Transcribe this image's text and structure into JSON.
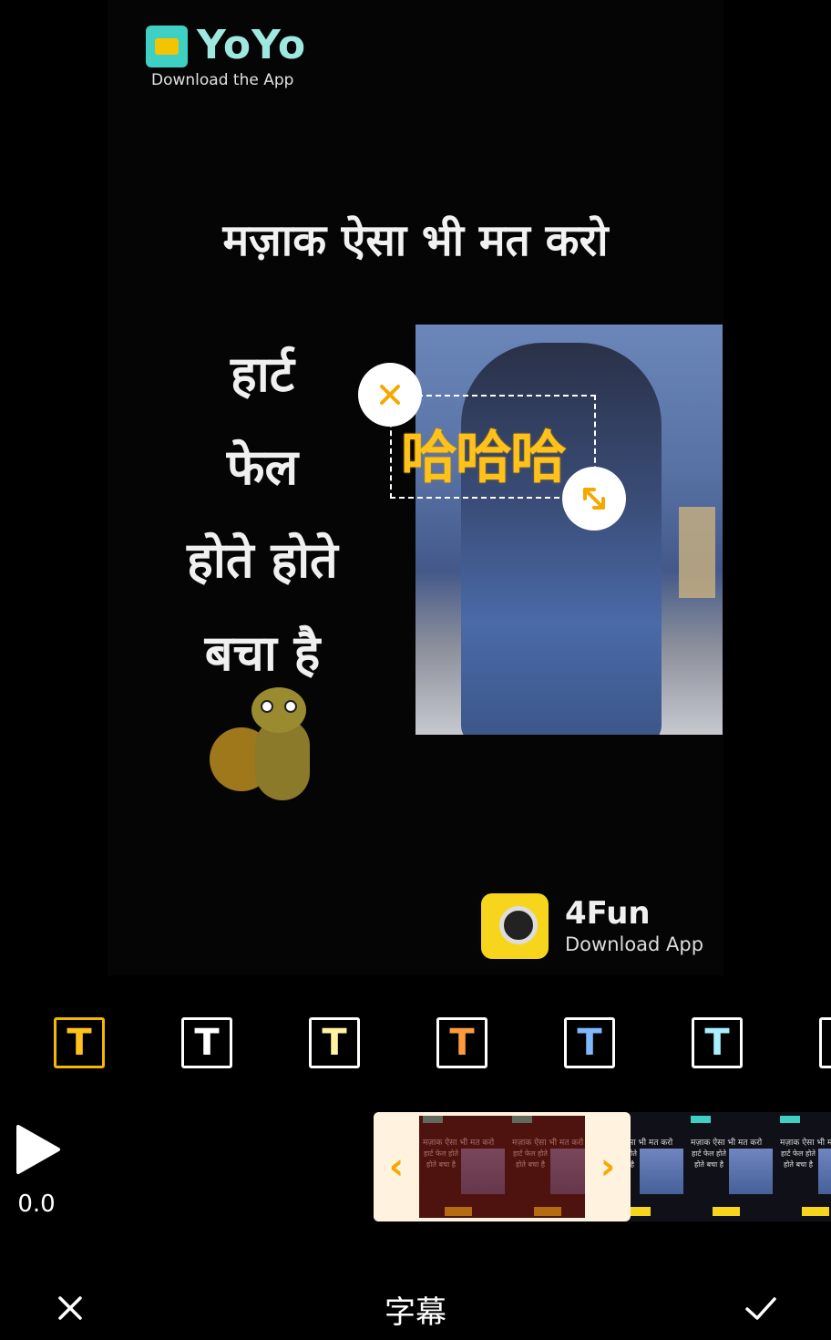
{
  "preview": {
    "watermark_top": {
      "name": "YoYo",
      "subtitle": "Download the App"
    },
    "title": "मज़ाक ऐसा भी मत करो",
    "lines": [
      "हार्ट",
      "फेल",
      "होते होते",
      "बचा है"
    ],
    "watermark_bottom": {
      "name": "4Fun",
      "subtitle": "Download App"
    }
  },
  "overlay": {
    "text": "哈哈哈",
    "text_color": "#ffc21a",
    "close_icon": "close-icon",
    "resize_icon": "resize-arrows-icon"
  },
  "styles": {
    "glyph": "T",
    "items": [
      {
        "fill": "#ffc21a",
        "active": true
      },
      {
        "fill": "#ffffff",
        "active": false
      },
      {
        "fill": "#fff3a0",
        "active": false
      },
      {
        "fill": "#ff9a3c",
        "active": false
      },
      {
        "fill": "#7fb8ff",
        "active": false
      },
      {
        "fill": "#a8f0ff",
        "active": false
      }
    ]
  },
  "timeline": {
    "time": "0.0",
    "play_icon": "play-icon",
    "left_handle": "‹",
    "right_handle": "›",
    "frame_title": "मज़ाक ऐसा भी मत करो",
    "frame_lines": "हार्ट फेल होते होते बचा है",
    "selection_color": "#f5a800"
  },
  "bottom_bar": {
    "title": "字幕",
    "cancel_icon": "close-icon",
    "confirm_icon": "check-icon"
  }
}
